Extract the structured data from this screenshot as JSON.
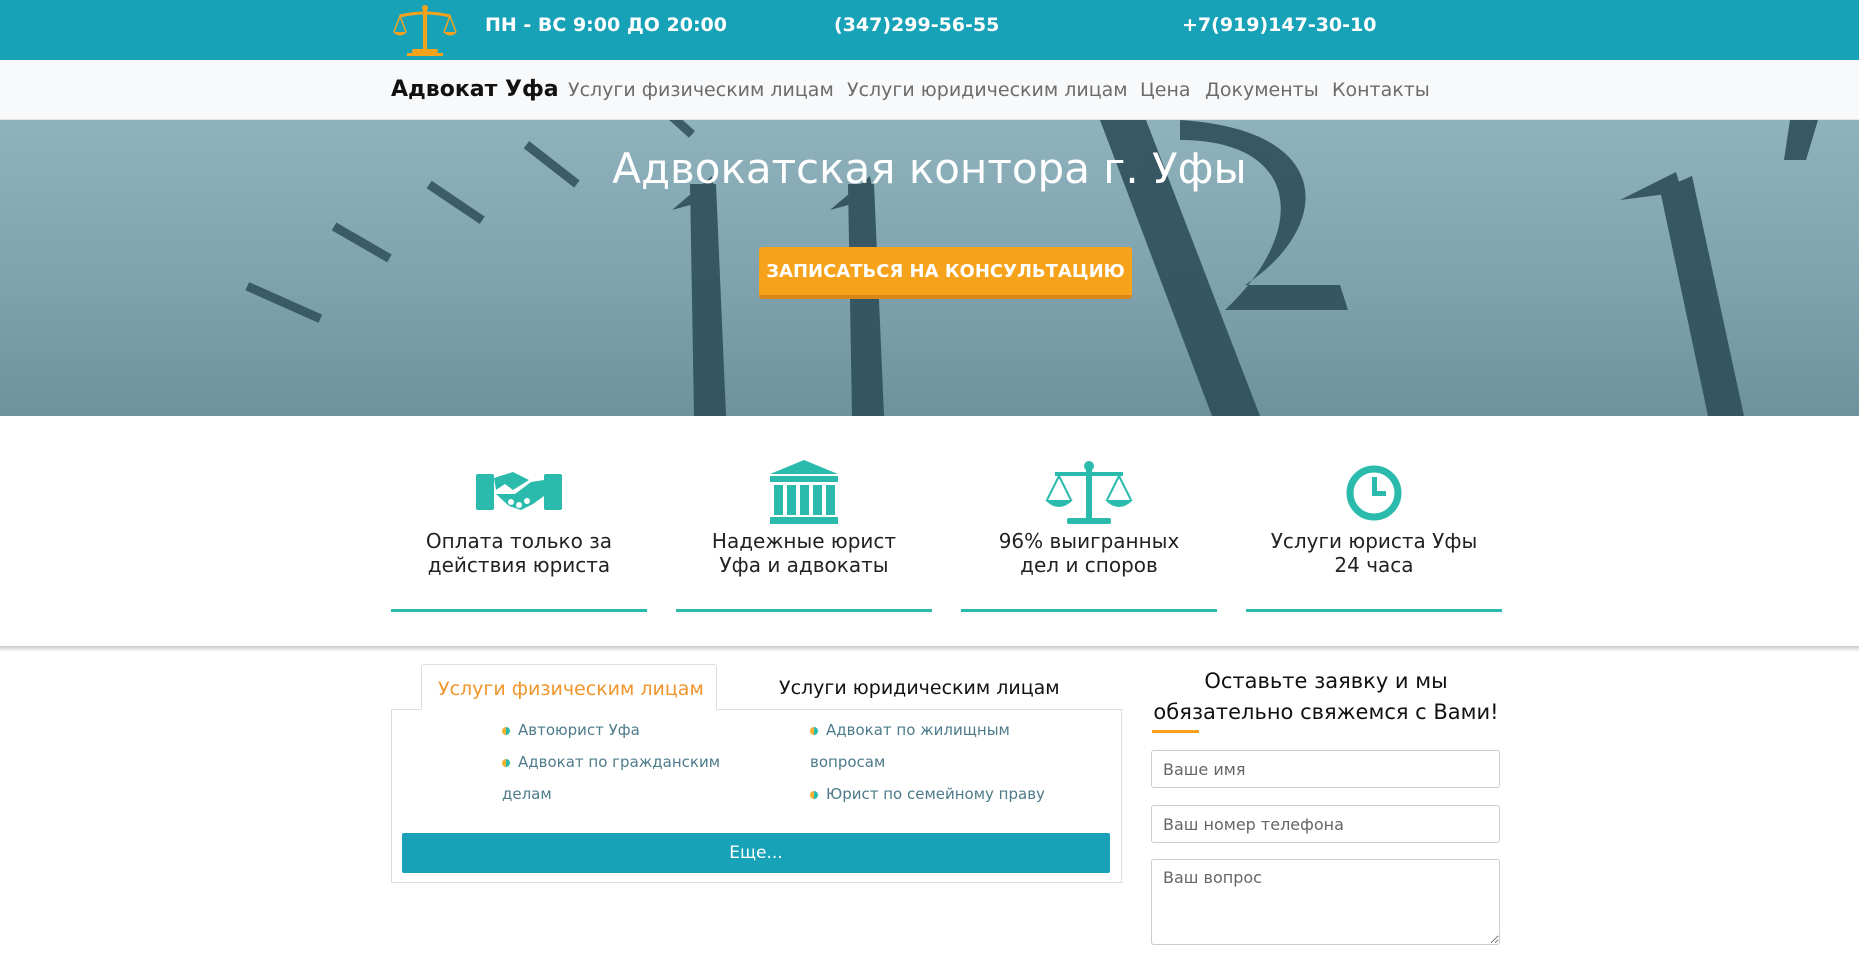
{
  "topbar": {
    "hours": "ПН - ВС 9:00 ДО 20:00",
    "phone1": "(347)299-56-55",
    "phone2": "+7(919)147-30-10",
    "logo_icon": "scales-of-justice-logo"
  },
  "nav": {
    "brand": "Адвокат Уфа",
    "items": [
      {
        "label": "Услуги физическим лицам"
      },
      {
        "label": "Услуги юридическим лицам"
      },
      {
        "label": "Цена"
      },
      {
        "label": "Документы"
      },
      {
        "label": "Контакты"
      }
    ]
  },
  "hero": {
    "title": "Адвокатская контора г. Уфы",
    "cta_label": "ЗАПИСАТЬСЯ НА КОНСУЛЬТАЦИЮ"
  },
  "features": [
    {
      "icon": "handshake-icon",
      "line1": "Оплата только за",
      "line2": "действия юриста"
    },
    {
      "icon": "courthouse-icon",
      "line1": "Надежные юрист",
      "line2": "Уфа и адвокаты"
    },
    {
      "icon": "scales-icon",
      "line1": "96% выигранных",
      "line2": "дел и споров"
    },
    {
      "icon": "clock-icon",
      "line1": "Услуги юриста Уфы",
      "line2": "24 часа"
    }
  ],
  "tabs": {
    "active": "Услуги физическим лицам",
    "inactive": "Услуги юридическим лицам"
  },
  "services": {
    "col1": [
      {
        "line1": "Автоюрист Уфа",
        "line2": ""
      },
      {
        "line1": "Адвокат по гражданским",
        "line2": "делам"
      }
    ],
    "col2": [
      {
        "line1": "Адвокат по жилищным",
        "line2": "вопросам"
      },
      {
        "line1": "Юрист по семейному праву",
        "line2": ""
      }
    ],
    "more_label": "Еще..."
  },
  "form": {
    "title_line1": "Оставьте заявку и мы",
    "title_line2": "обязательно свяжемся с Вами!",
    "name_placeholder": "Ваше имя",
    "phone_placeholder": "Ваш номер телефона",
    "question_placeholder": "Ваш вопрос"
  },
  "colors": {
    "brand_teal": "#17a2b8",
    "accent_orange": "#f7a21b",
    "icon_teal": "#2bbbad"
  }
}
